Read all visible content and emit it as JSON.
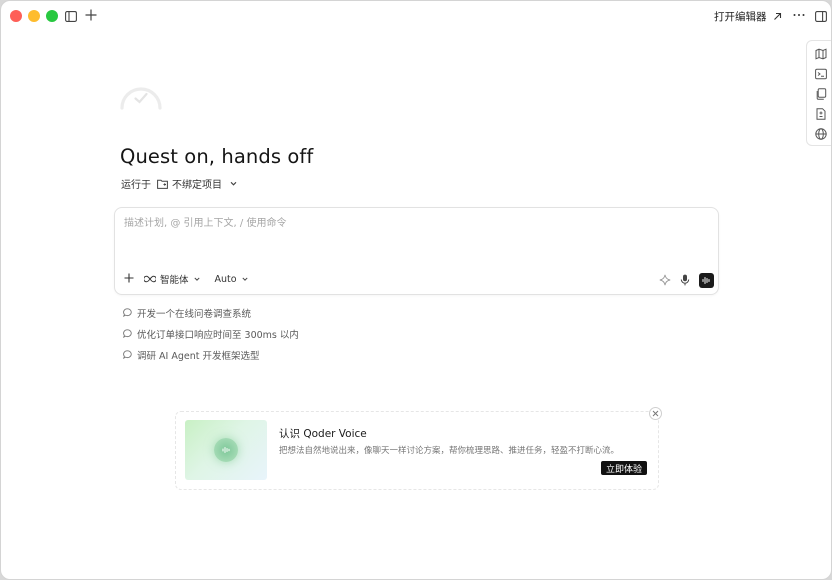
{
  "window": {
    "traffic_colors": {
      "close": "#fe5f57",
      "minimize": "#febc2e",
      "zoom": "#28c840"
    },
    "toolbar": {
      "sidebar_toggle_icon": "sidebar-left-icon",
      "new_icon": "plus-icon",
      "open_editor_label": "打开编辑器",
      "open_editor_icon": "arrow-up-right-icon",
      "more_icon": "ellipsis-icon",
      "panel_icon": "sidebar-right-icon"
    }
  },
  "rail": {
    "items": [
      "map-icon",
      "terminal-icon",
      "copy-icon",
      "file-diff-icon",
      "globe-icon"
    ]
  },
  "main": {
    "title": "Quest on, hands off",
    "runs_label": "运行于",
    "project_label": "不绑定项目"
  },
  "composer": {
    "placeholder": "描述计划, @ 引用上下文, / 使用命令",
    "value": "",
    "mode_label": "智能体",
    "model_label": "Auto"
  },
  "suggestions": [
    "开发一个在线问卷调查系统",
    "优化订单接口响应时间至 300ms 以内",
    "调研 AI Agent 开发框架选型"
  ],
  "promo": {
    "title": "认识 Qoder Voice",
    "description": "把想法自然地说出来，像聊天一样讨论方案，帮你梳理思路、推进任务，轻盈不打断心流。",
    "cta": "立即体验"
  }
}
